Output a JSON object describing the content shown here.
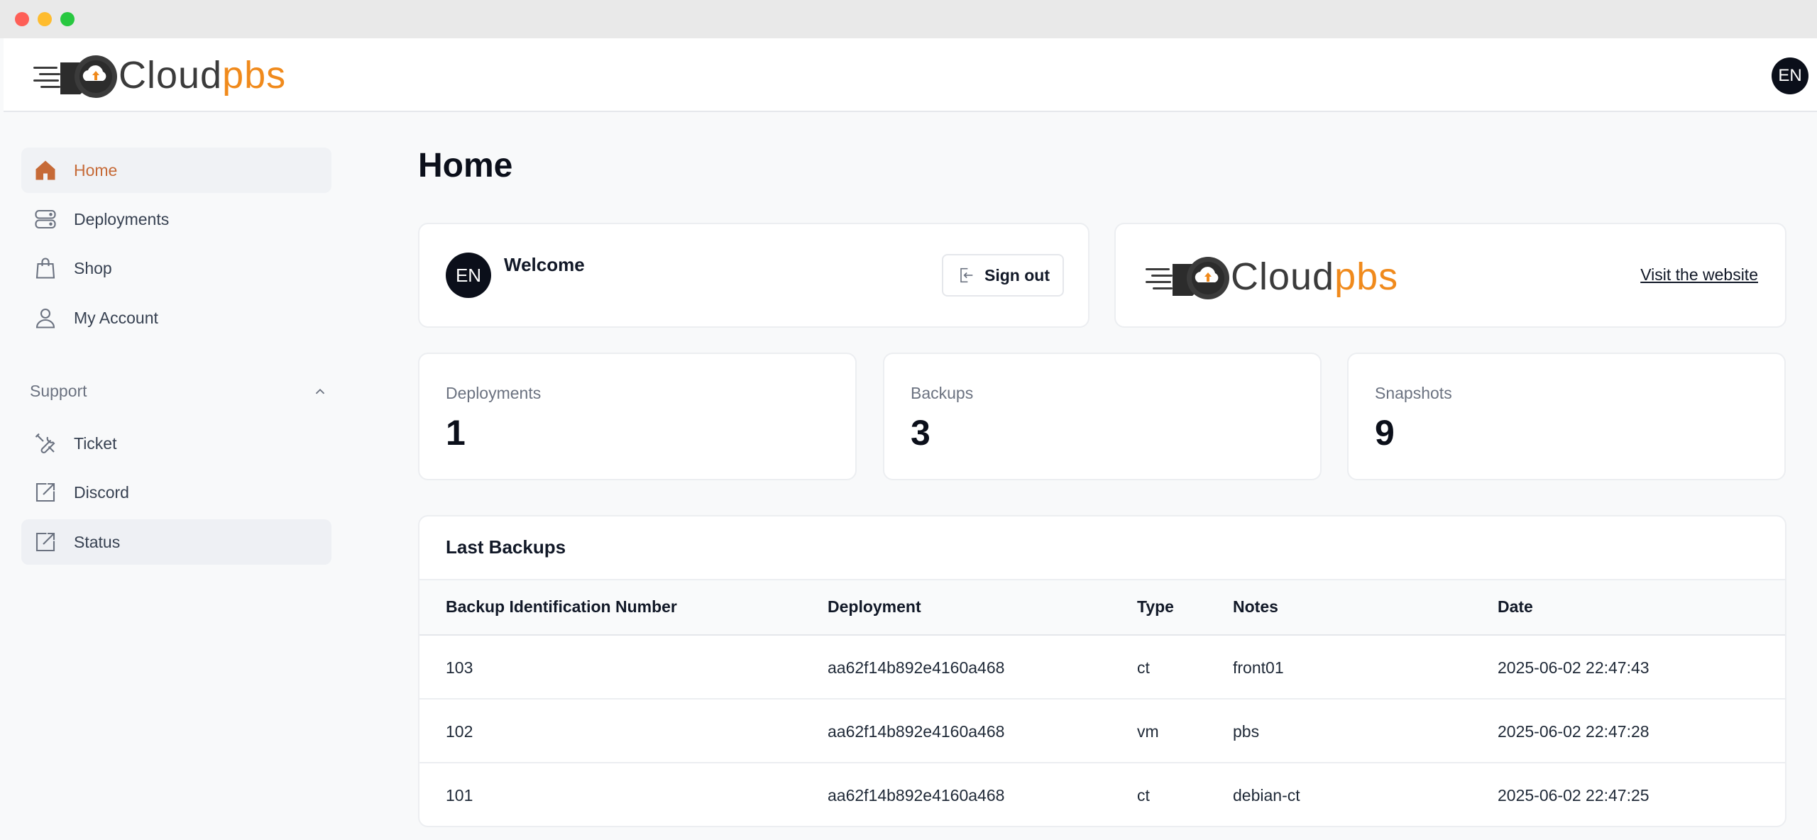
{
  "brand": {
    "name_part1": "Cloud",
    "name_part2": "pbs"
  },
  "user": {
    "initials": "EN"
  },
  "sidebar": {
    "items": [
      {
        "label": "Home",
        "icon": "home-icon"
      },
      {
        "label": "Deployments",
        "icon": "server-icon"
      },
      {
        "label": "Shop",
        "icon": "shopping-bag-icon"
      },
      {
        "label": "My Account",
        "icon": "user-icon"
      }
    ],
    "support": {
      "label": "Support",
      "items": [
        {
          "label": "Ticket",
          "icon": "wrench-icon"
        },
        {
          "label": "Discord",
          "icon": "external-link-icon"
        },
        {
          "label": "Status",
          "icon": "external-link-icon"
        }
      ]
    }
  },
  "page": {
    "title": "Home"
  },
  "welcome": {
    "text": "Welcome",
    "signout_label": "Sign out"
  },
  "website": {
    "link_label": "Visit the website"
  },
  "stats": [
    {
      "label": "Deployments",
      "value": "1"
    },
    {
      "label": "Backups",
      "value": "3"
    },
    {
      "label": "Snapshots",
      "value": "9"
    }
  ],
  "backups": {
    "title": "Last Backups",
    "columns": [
      "Backup Identification Number",
      "Deployment",
      "Type",
      "Notes",
      "Date"
    ],
    "rows": [
      [
        "103",
        "aa62f14b892e4160a468",
        "ct",
        "front01",
        "2025-06-02 22:47:43"
      ],
      [
        "102",
        "aa62f14b892e4160a468",
        "vm",
        "pbs",
        "2025-06-02 22:47:28"
      ],
      [
        "101",
        "aa62f14b892e4160a468",
        "ct",
        "debian-ct",
        "2025-06-02 22:47:25"
      ]
    ]
  },
  "colors": {
    "accent": "#c66a37",
    "brand_orange": "#f08a1c",
    "dark": "#0b0f1a"
  }
}
